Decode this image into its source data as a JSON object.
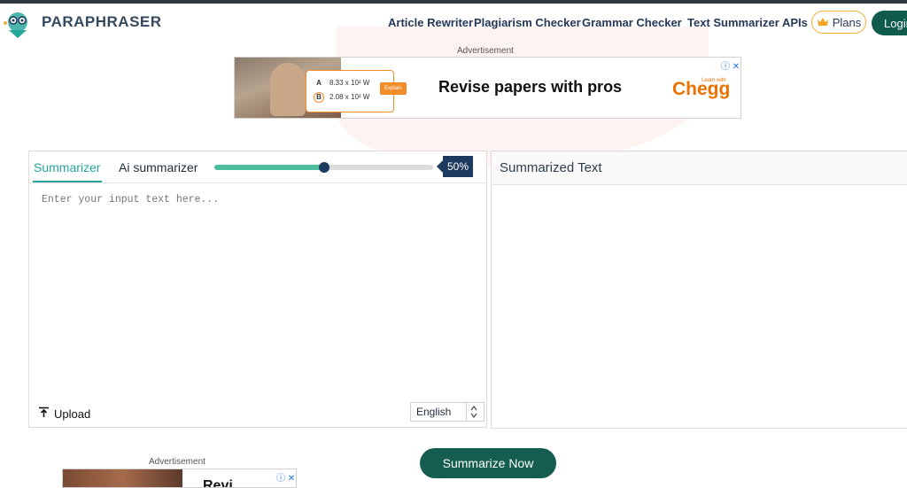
{
  "header": {
    "brand": "PARAPHRASER",
    "nav": [
      "Article Rewriter",
      "Plagiarism Checker",
      "Grammar Checker",
      "Text Summarizer",
      "APIs"
    ],
    "plans_label": "Plans",
    "login_label": "Login"
  },
  "ad_top": {
    "label": "Advertisement",
    "row_a_letter": "A",
    "row_a_value": "8.33 x 10² W",
    "row_b_letter": "B",
    "row_b_value": "2.08 x 10² W",
    "explain_label": "Explain",
    "headline": "Revise papers with pros",
    "learn_with": "Learn with",
    "brand": "Chegg"
  },
  "summarizer": {
    "tabs": [
      "Summarizer",
      "Ai summarizer"
    ],
    "active_tab": 0,
    "length_percent": 50,
    "length_label": "50%",
    "input_placeholder": "Enter your input text here...",
    "upload_label": "Upload",
    "language": "English",
    "output_title": "Summarized Text",
    "submit_label": "Summarize Now"
  },
  "ad_bottom": {
    "label": "Advertisement",
    "headline": "Revi"
  },
  "colors": {
    "accent": "#26a69a",
    "primary_dark": "#155e4f",
    "navy": "#1e3a5f",
    "plans_border": "#f5b041",
    "chegg_orange": "#eb7100"
  },
  "icons": [
    "logo-icon",
    "crown-icon",
    "upload-icon",
    "sort-arrows-icon",
    "ad-info-icon",
    "ad-close-icon"
  ]
}
